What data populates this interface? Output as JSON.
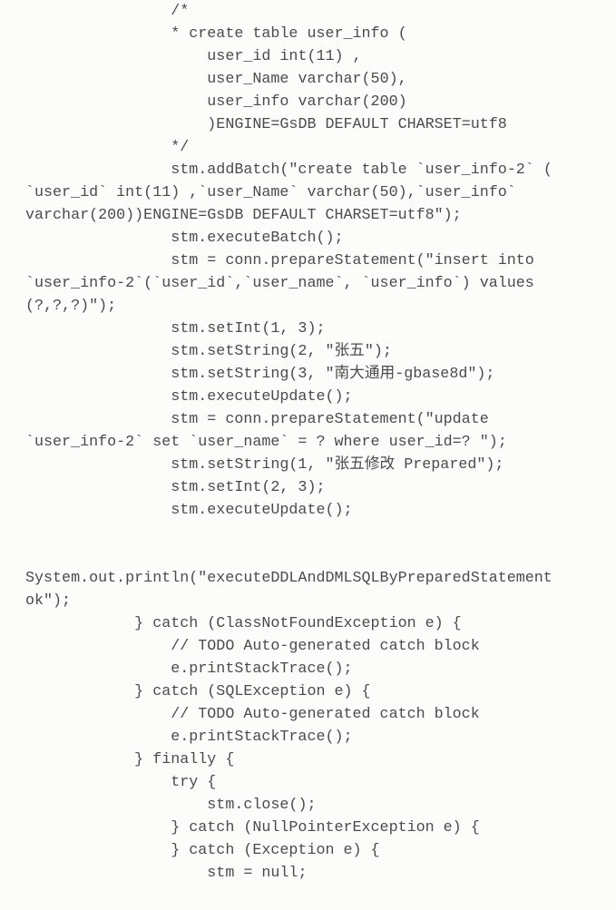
{
  "code": "                /*\n                * create table user_info (\n                    user_id int(11) ,\n                    user_Name varchar(50),\n                    user_info varchar(200)\n                    )ENGINE=GsDB DEFAULT CHARSET=utf8\n                */\n                stm.addBatch(\"create table `user_info-2` ( `user_id` int(11) ,`user_Name` varchar(50),`user_info` varchar(200))ENGINE=GsDB DEFAULT CHARSET=utf8\");\n                stm.executeBatch();\n                stm = conn.prepareStatement(\"insert into `user_info-2`(`user_id`,`user_name`, `user_info`) values (?,?,?)\");\n                stm.setInt(1, 3);\n                stm.setString(2, \"张五\");\n                stm.setString(3, \"南大通用-gbase8d\");\n                stm.executeUpdate();\n                stm = conn.prepareStatement(\"update `user_info-2` set `user_name` = ? where user_id=? \");\n                stm.setString(1, \"张五修改 Prepared\");\n                stm.setInt(2, 3);\n                stm.executeUpdate();\n\n                System.out.println(\"executeDDLAndDMLSQLByPreparedStatement ok\");\n            } catch (ClassNotFoundException e) {\n                // TODO Auto-generated catch block\n                e.printStackTrace();\n            } catch (SQLException e) {\n                // TODO Auto-generated catch block\n                e.printStackTrace();\n            } finally {\n                try {\n                    stm.close();\n                } catch (NullPointerException e) {\n                } catch (Exception e) {\n                    stm = null;"
}
